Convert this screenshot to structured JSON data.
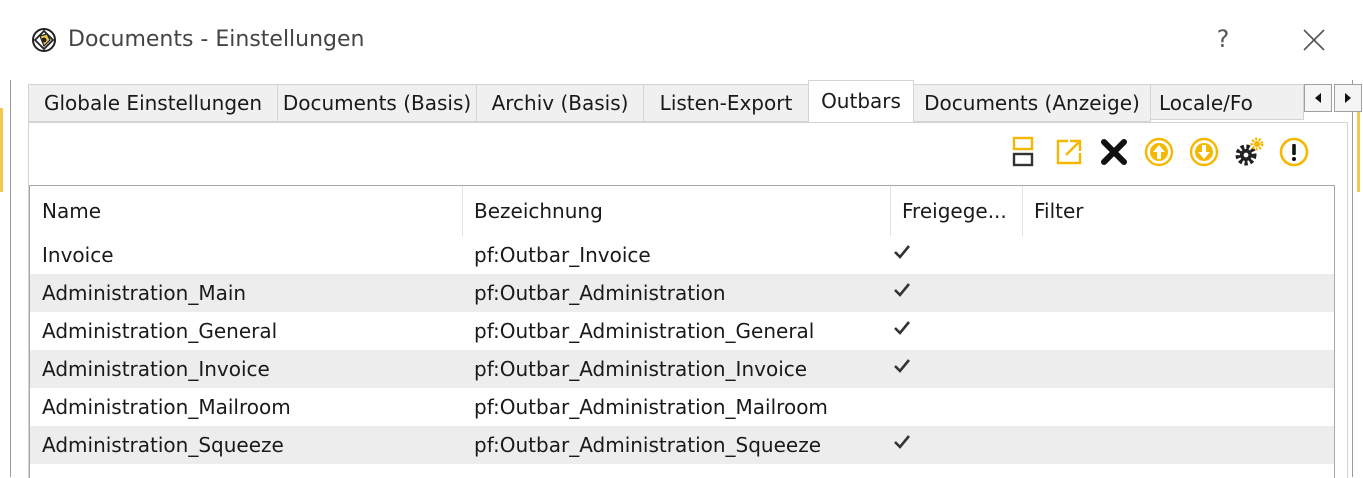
{
  "window": {
    "title": "Documents - Einstellungen",
    "help_label": "?"
  },
  "tabs": [
    {
      "label": "Globale Einstellungen",
      "active": false
    },
    {
      "label": "Documents (Basis)",
      "active": false
    },
    {
      "label": "Archiv (Basis)",
      "active": false
    },
    {
      "label": "Listen-Export",
      "active": false
    },
    {
      "label": "Outbars",
      "active": true
    },
    {
      "label": "Documents (Anzeige)",
      "active": false
    },
    {
      "label": "Locale/Fo",
      "active": false
    }
  ],
  "toolbar": {
    "icons": [
      "add-icon",
      "edit-icon",
      "delete-icon",
      "move-up-icon",
      "move-down-icon",
      "settings-icon",
      "warning-icon"
    ],
    "accent_color": "#f5b800"
  },
  "table": {
    "columns": [
      "Name",
      "Bezeichnung",
      "Freigege...",
      "Filter"
    ],
    "rows": [
      {
        "name": "Invoice",
        "bezeichnung": "pf:Outbar_Invoice",
        "freigegeben": true,
        "filter": ""
      },
      {
        "name": "Administration_Main",
        "bezeichnung": "pf:Outbar_Administration",
        "freigegeben": true,
        "filter": ""
      },
      {
        "name": "Administration_General",
        "bezeichnung": "pf:Outbar_Administration_General",
        "freigegeben": true,
        "filter": ""
      },
      {
        "name": "Administration_Invoice",
        "bezeichnung": "pf:Outbar_Administration_Invoice",
        "freigegeben": true,
        "filter": ""
      },
      {
        "name": "Administration_Mailroom",
        "bezeichnung": "pf:Outbar_Administration_Mailroom",
        "freigegeben": false,
        "filter": ""
      },
      {
        "name": "Administration_Squeeze",
        "bezeichnung": "pf:Outbar_Administration_Squeeze",
        "freigegeben": true,
        "filter": ""
      }
    ]
  }
}
